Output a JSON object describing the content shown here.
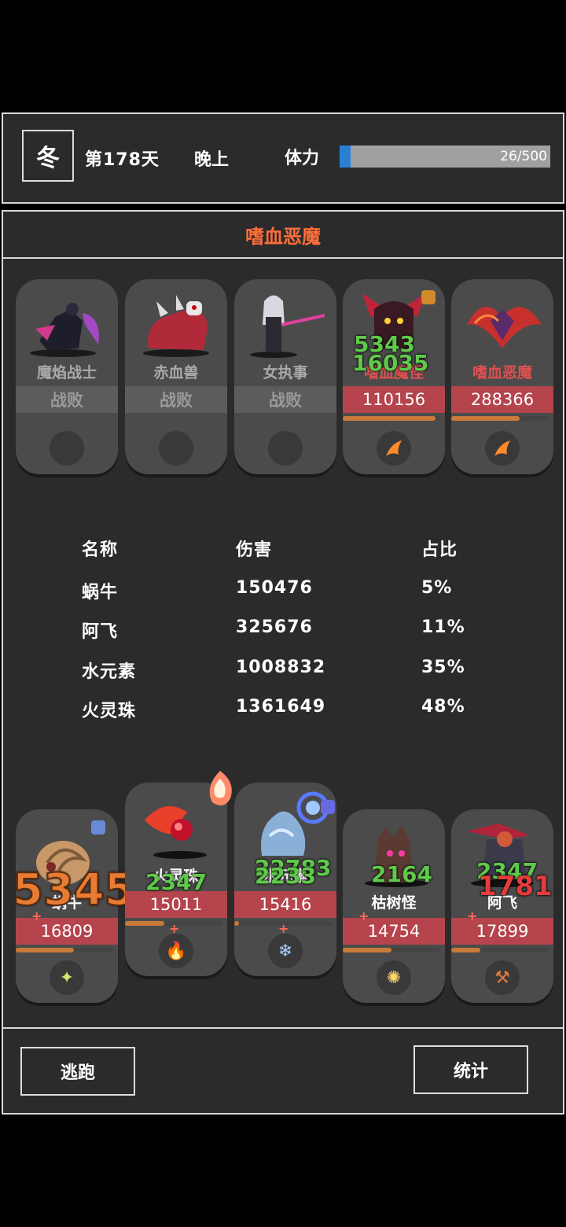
{
  "header": {
    "season": "冬",
    "day": "第178天",
    "time_of_day": "晚上",
    "stamina_label": "体力",
    "stamina_text": "26/500",
    "stamina_value": 26,
    "stamina_max": 500
  },
  "battle": {
    "title": "嗜血恶魔",
    "enemies": [
      {
        "name": "魔焰战士",
        "status": "战败",
        "defeated": true
      },
      {
        "name": "赤血兽",
        "status": "战败",
        "defeated": true
      },
      {
        "name": "女执事",
        "status": "战败",
        "defeated": true
      },
      {
        "name": "嗜血魔怪",
        "hp": "110156",
        "defeated": false,
        "energy": 0.95,
        "float_numbers": [
          "5343",
          "16035"
        ]
      },
      {
        "name": "嗜血恶魔",
        "hp": "288366",
        "defeated": false,
        "energy": 0.7,
        "float_numbers": []
      }
    ],
    "stats": {
      "headers": [
        "名称",
        "伤害",
        "占比"
      ],
      "rows": [
        [
          "蜗牛",
          "150476",
          "5%"
        ],
        [
          "阿飞",
          "325676",
          "11%"
        ],
        [
          "水元素",
          "1008832",
          "35%"
        ],
        [
          "火灵珠",
          "1361649",
          "48%"
        ]
      ]
    },
    "allies": [
      {
        "name": "蜗牛",
        "hp": "16809",
        "energy": 0.6,
        "float_numbers": [
          "5345"
        ],
        "skill_icon": "✦"
      },
      {
        "name": "火灵珠",
        "hp": "15011",
        "energy": 0.4,
        "float_numbers": [
          "2347"
        ],
        "skill_icon": "🔥"
      },
      {
        "name": "水元素",
        "hp": "15416",
        "energy": 0.05,
        "float_numbers": [
          "22783",
          "2233"
        ],
        "skill_icon": "❄"
      },
      {
        "name": "枯树怪",
        "hp": "14754",
        "energy": 0.5,
        "float_numbers": [
          "2164"
        ],
        "skill_icon": "✺"
      },
      {
        "name": "阿飞",
        "hp": "17899",
        "energy": 0.3,
        "float_numbers": [
          "2347",
          "1781"
        ],
        "skill_icon": "⚒"
      }
    ],
    "buttons": {
      "flee": "逃跑",
      "stats": "统计"
    },
    "colors": {
      "title": "#ff6e3a",
      "hp_bar": "#b5444c",
      "stamina_fill": "#2a7fd4",
      "heal_number": "#5fc94a",
      "damage_number": "#e53b3b"
    }
  }
}
